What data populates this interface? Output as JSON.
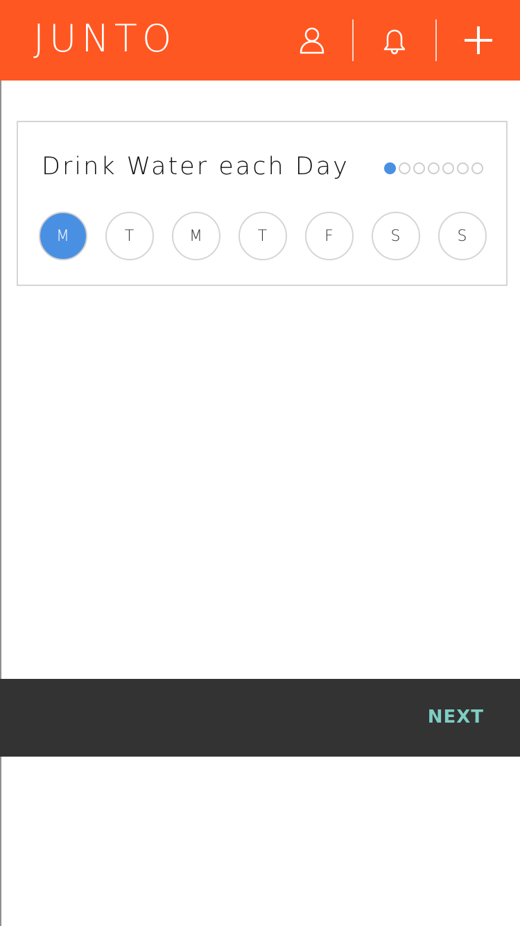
{
  "header": {
    "brand": "JUNTO",
    "icons": [
      "user-icon",
      "bell-icon",
      "plus-icon"
    ],
    "background_color": "#ff5722"
  },
  "habit": {
    "title": "Drink Water each Day",
    "progress": {
      "completed": 1,
      "total": 7
    },
    "days": [
      {
        "label": "M",
        "selected": true
      },
      {
        "label": "T",
        "selected": false
      },
      {
        "label": "M",
        "selected": false
      },
      {
        "label": "T",
        "selected": false
      },
      {
        "label": "F",
        "selected": false
      },
      {
        "label": "S",
        "selected": false
      },
      {
        "label": "S",
        "selected": false
      }
    ],
    "accent_color": "#4a90e2"
  },
  "footer": {
    "next_label": "NEXT",
    "background_color": "#333333",
    "next_color": "#7ecec4"
  }
}
